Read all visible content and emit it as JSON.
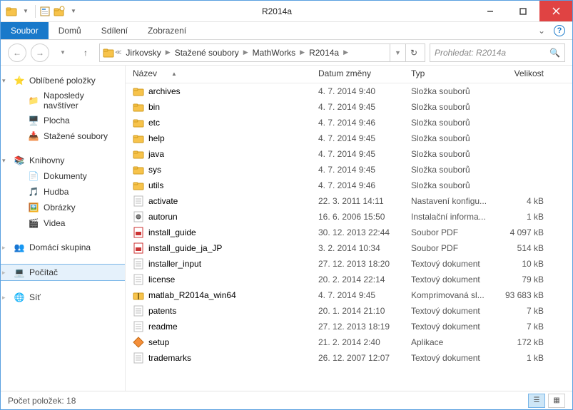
{
  "window": {
    "title": "R2014a"
  },
  "ribbon": {
    "tabs": [
      "Soubor",
      "Domů",
      "Sdílení",
      "Zobrazení"
    ]
  },
  "breadcrumbs": {
    "segments": [
      "Jirkovsky",
      "Stažené soubory",
      "MathWorks",
      "R2014a"
    ]
  },
  "search": {
    "placeholder": "Prohledat: R2014a"
  },
  "sidebar": {
    "favorites": {
      "label": "Oblíbené položky",
      "items": [
        "Naposledy navštíver",
        "Plocha",
        "Stažené soubory"
      ]
    },
    "libraries": {
      "label": "Knihovny",
      "items": [
        "Dokumenty",
        "Hudba",
        "Obrázky",
        "Videa"
      ]
    },
    "homegroup": {
      "label": "Domácí skupina"
    },
    "computer": {
      "label": "Počítač"
    },
    "network": {
      "label": "Síť"
    }
  },
  "columns": {
    "name": "Název",
    "date": "Datum změny",
    "type": "Typ",
    "size": "Velikost"
  },
  "rows": [
    {
      "icon": "folder",
      "name": "archives",
      "date": "4. 7. 2014 9:40",
      "type": "Složka souborů",
      "size": ""
    },
    {
      "icon": "folder",
      "name": "bin",
      "date": "4. 7. 2014 9:45",
      "type": "Složka souborů",
      "size": ""
    },
    {
      "icon": "folder",
      "name": "etc",
      "date": "4. 7. 2014 9:46",
      "type": "Složka souborů",
      "size": ""
    },
    {
      "icon": "folder",
      "name": "help",
      "date": "4. 7. 2014 9:45",
      "type": "Složka souborů",
      "size": ""
    },
    {
      "icon": "folder",
      "name": "java",
      "date": "4. 7. 2014 9:45",
      "type": "Složka souborů",
      "size": ""
    },
    {
      "icon": "folder",
      "name": "sys",
      "date": "4. 7. 2014 9:45",
      "type": "Složka souborů",
      "size": ""
    },
    {
      "icon": "folder",
      "name": "utils",
      "date": "4. 7. 2014 9:46",
      "type": "Složka souborů",
      "size": ""
    },
    {
      "icon": "txt",
      "name": "activate",
      "date": "22. 3. 2011 14:11",
      "type": "Nastavení konfigu...",
      "size": "4 kB"
    },
    {
      "icon": "inf",
      "name": "autorun",
      "date": "16. 6. 2006 15:50",
      "type": "Instalační informa...",
      "size": "1 kB"
    },
    {
      "icon": "pdf",
      "name": "install_guide",
      "date": "30. 12. 2013 22:44",
      "type": "Soubor PDF",
      "size": "4 097 kB"
    },
    {
      "icon": "pdf",
      "name": "install_guide_ja_JP",
      "date": "3. 2. 2014 10:34",
      "type": "Soubor PDF",
      "size": "514 kB"
    },
    {
      "icon": "txt",
      "name": "installer_input",
      "date": "27. 12. 2013 18:20",
      "type": "Textový dokument",
      "size": "10 kB"
    },
    {
      "icon": "txt",
      "name": "license",
      "date": "20. 2. 2014 22:14",
      "type": "Textový dokument",
      "size": "79 kB"
    },
    {
      "icon": "zip",
      "name": "matlab_R2014a_win64",
      "date": "4. 7. 2014 9:45",
      "type": "Komprimovaná sl...",
      "size": "93 683 kB"
    },
    {
      "icon": "txt",
      "name": "patents",
      "date": "20. 1. 2014 21:10",
      "type": "Textový dokument",
      "size": "7 kB"
    },
    {
      "icon": "txt",
      "name": "readme",
      "date": "27. 12. 2013 18:19",
      "type": "Textový dokument",
      "size": "7 kB"
    },
    {
      "icon": "exe",
      "name": "setup",
      "date": "21. 2. 2014 2:40",
      "type": "Aplikace",
      "size": "172 kB"
    },
    {
      "icon": "txt",
      "name": "trademarks",
      "date": "26. 12. 2007 12:07",
      "type": "Textový dokument",
      "size": "1 kB"
    }
  ],
  "status": {
    "count_label": "Počet položek: 18"
  }
}
